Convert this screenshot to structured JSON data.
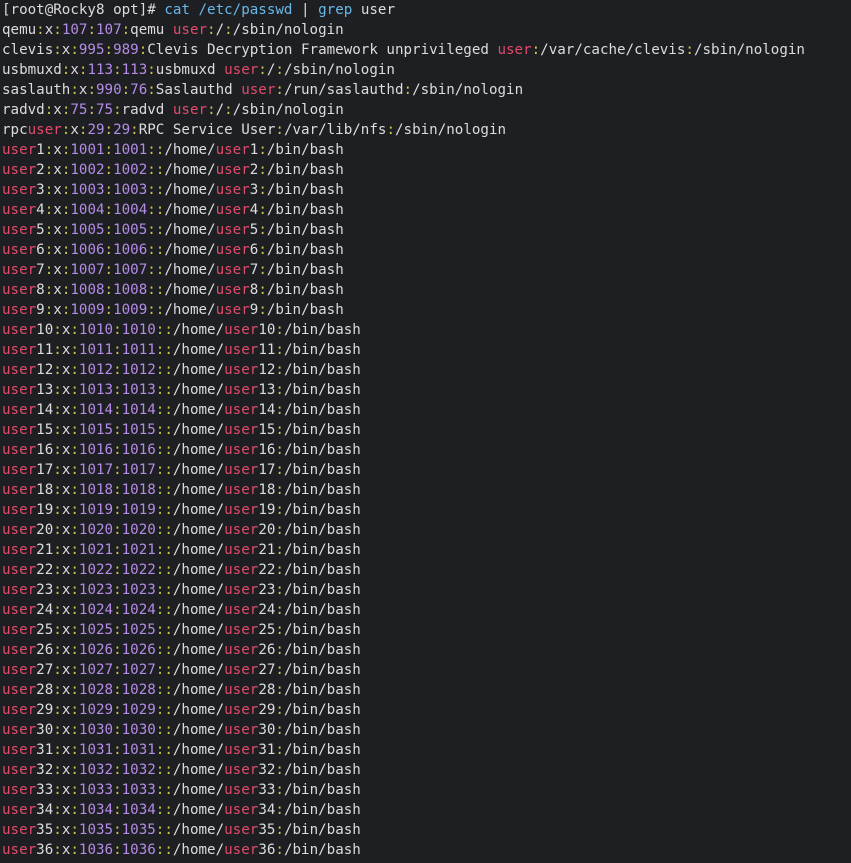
{
  "prompt": {
    "open_bracket": "[",
    "user_host": "root@Rocky8",
    "cwd": "opt",
    "close_bracket": "]",
    "hash": "#"
  },
  "command": {
    "cat": "cat",
    "path": "/etc/passwd",
    "pipe": "|",
    "grep": "grep",
    "pattern": "user"
  },
  "search_term": "user",
  "colors": {
    "background": "#1e1f22",
    "text": "#dcdcdc",
    "separator": "#d2c84a",
    "number": "#b48ce6",
    "highlight": "#e24a6a",
    "command": "#68b8e8"
  },
  "output_lines": [
    "qemu:x:107:107:qemu user:/:/sbin/nologin",
    "clevis:x:995:989:Clevis Decryption Framework unprivileged user:/var/cache/clevis:/sbin/nologin",
    "usbmuxd:x:113:113:usbmuxd user:/:/sbin/nologin",
    "saslauth:x:990:76:Saslauthd user:/run/saslauthd:/sbin/nologin",
    "radvd:x:75:75:radvd user:/:/sbin/nologin",
    "rpcuser:x:29:29:RPC Service User:/var/lib/nfs:/sbin/nologin",
    "user1:x:1001:1001::/home/user1:/bin/bash",
    "user2:x:1002:1002::/home/user2:/bin/bash",
    "user3:x:1003:1003::/home/user3:/bin/bash",
    "user4:x:1004:1004::/home/user4:/bin/bash",
    "user5:x:1005:1005::/home/user5:/bin/bash",
    "user6:x:1006:1006::/home/user6:/bin/bash",
    "user7:x:1007:1007::/home/user7:/bin/bash",
    "user8:x:1008:1008::/home/user8:/bin/bash",
    "user9:x:1009:1009::/home/user9:/bin/bash",
    "user10:x:1010:1010::/home/user10:/bin/bash",
    "user11:x:1011:1011::/home/user11:/bin/bash",
    "user12:x:1012:1012::/home/user12:/bin/bash",
    "user13:x:1013:1013::/home/user13:/bin/bash",
    "user14:x:1014:1014::/home/user14:/bin/bash",
    "user15:x:1015:1015::/home/user15:/bin/bash",
    "user16:x:1016:1016::/home/user16:/bin/bash",
    "user17:x:1017:1017::/home/user17:/bin/bash",
    "user18:x:1018:1018::/home/user18:/bin/bash",
    "user19:x:1019:1019::/home/user19:/bin/bash",
    "user20:x:1020:1020::/home/user20:/bin/bash",
    "user21:x:1021:1021::/home/user21:/bin/bash",
    "user22:x:1022:1022::/home/user22:/bin/bash",
    "user23:x:1023:1023::/home/user23:/bin/bash",
    "user24:x:1024:1024::/home/user24:/bin/bash",
    "user25:x:1025:1025::/home/user25:/bin/bash",
    "user26:x:1026:1026::/home/user26:/bin/bash",
    "user27:x:1027:1027::/home/user27:/bin/bash",
    "user28:x:1028:1028::/home/user28:/bin/bash",
    "user29:x:1029:1029::/home/user29:/bin/bash",
    "user30:x:1030:1030::/home/user30:/bin/bash",
    "user31:x:1031:1031::/home/user31:/bin/bash",
    "user32:x:1032:1032::/home/user32:/bin/bash",
    "user33:x:1033:1033::/home/user33:/bin/bash",
    "user34:x:1034:1034::/home/user34:/bin/bash",
    "user35:x:1035:1035::/home/user35:/bin/bash",
    "user36:x:1036:1036::/home/user36:/bin/bash"
  ]
}
